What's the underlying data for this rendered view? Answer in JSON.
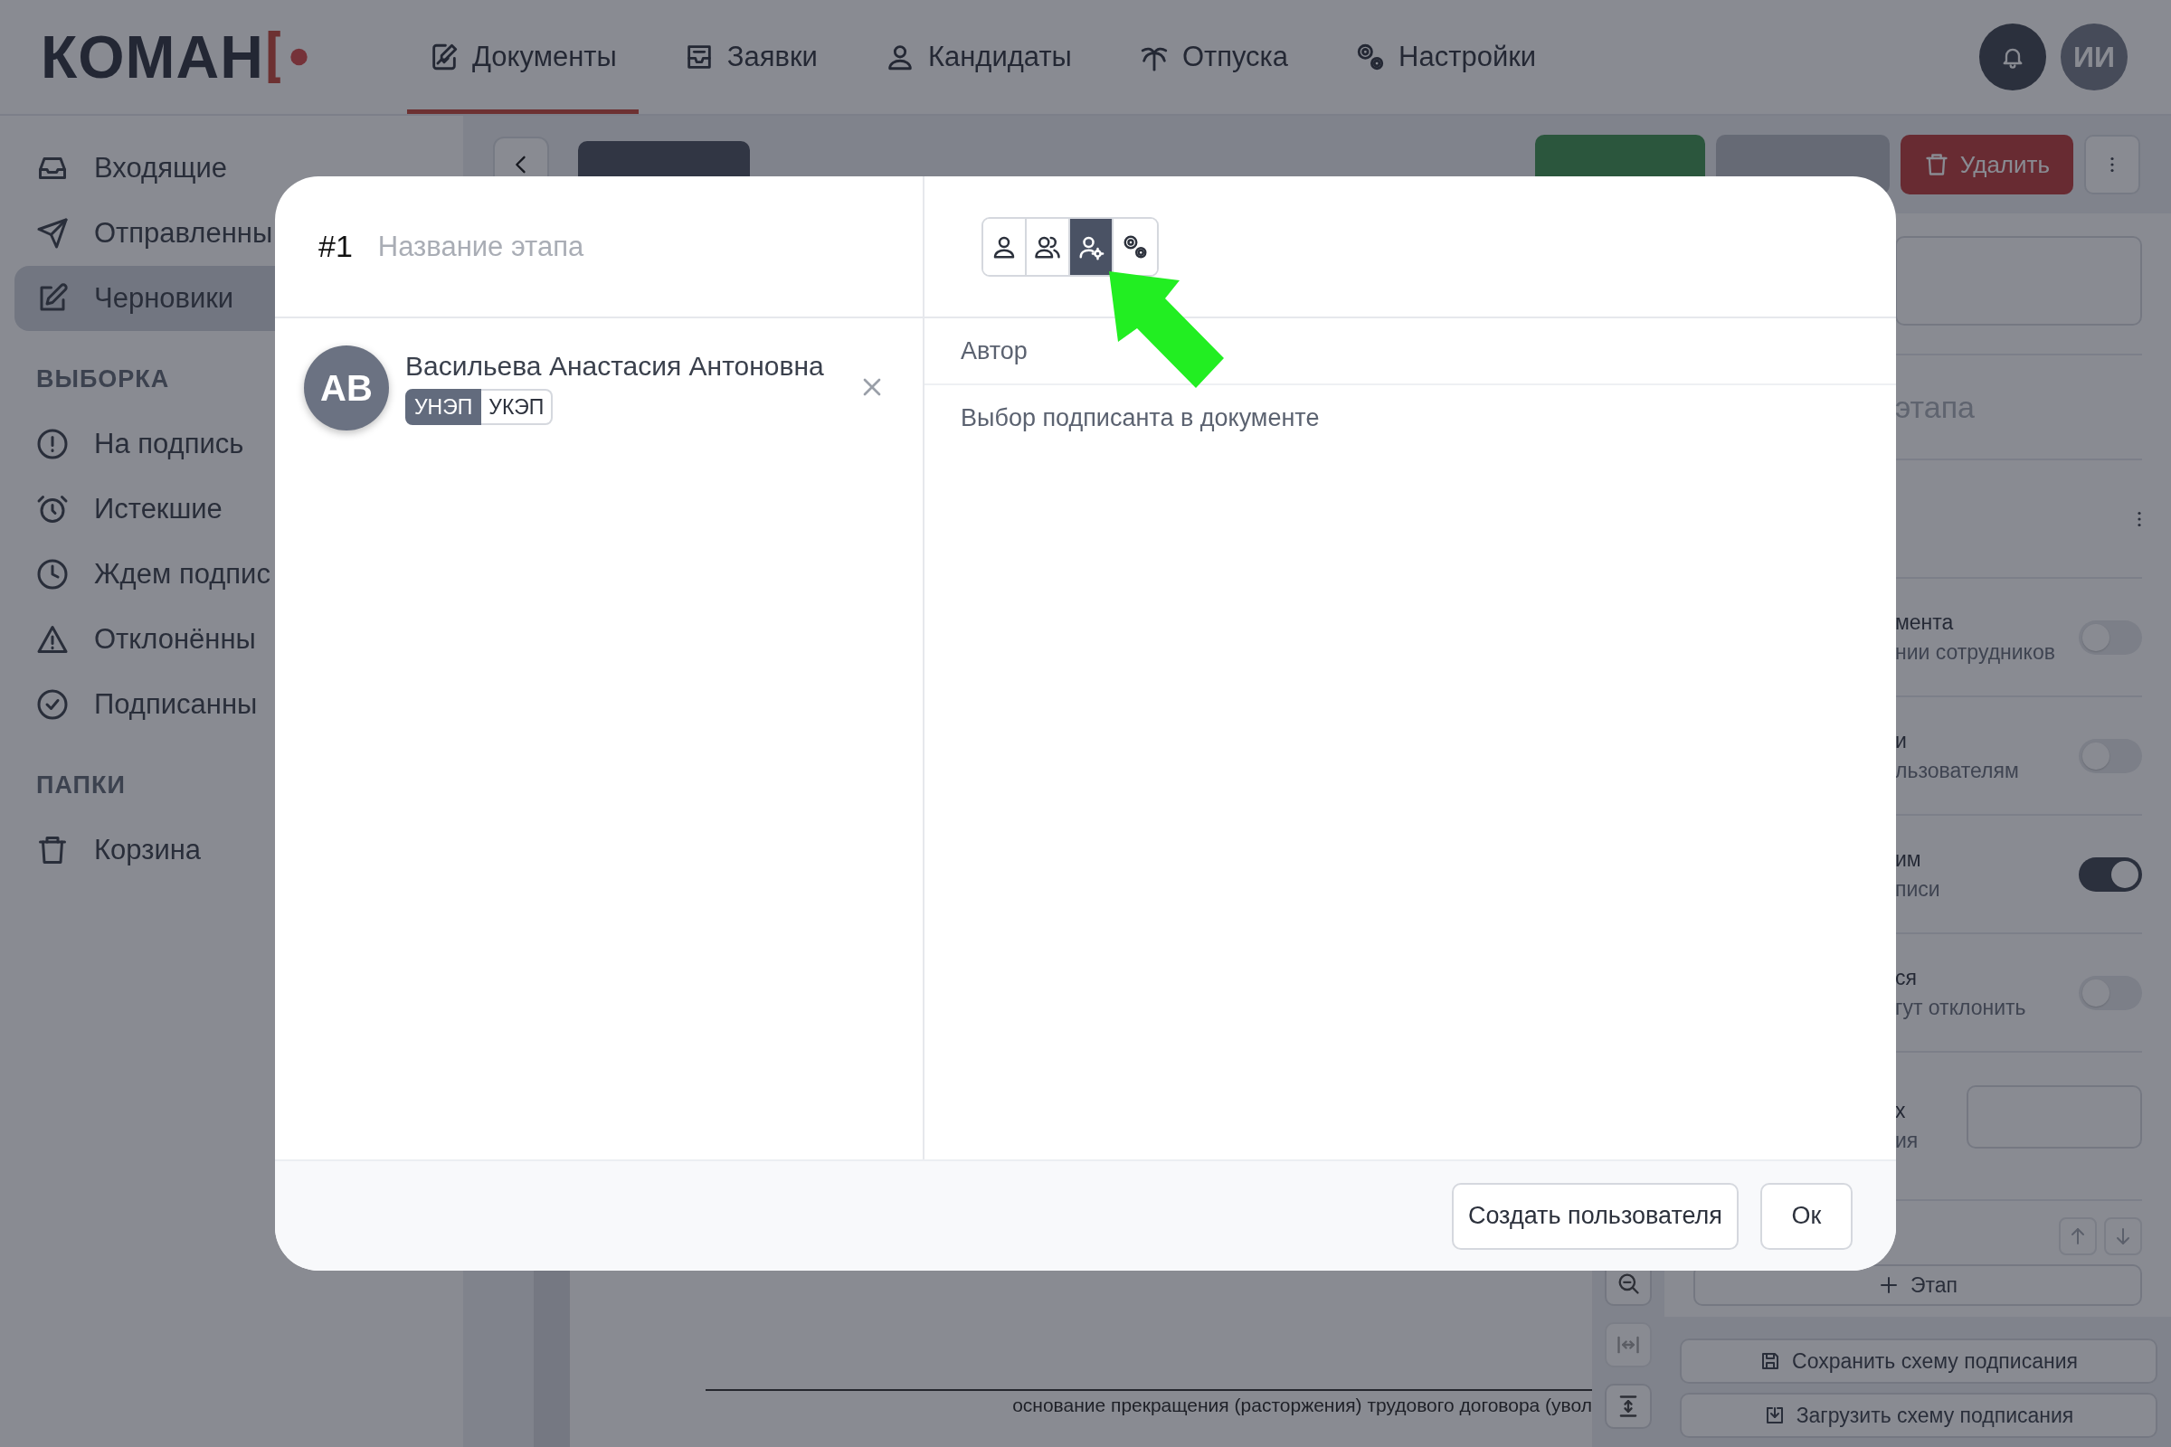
{
  "logo": {
    "text": "КОМАН"
  },
  "nav": [
    {
      "label": "Документы",
      "selected": true
    },
    {
      "label": "Заявки",
      "selected": false
    },
    {
      "label": "Кандидаты",
      "selected": false
    },
    {
      "label": "Отпуска",
      "selected": false
    },
    {
      "label": "Настройки",
      "selected": false
    }
  ],
  "user": {
    "initials": "ИИ"
  },
  "sidebar": {
    "items": [
      {
        "label": "Входящие",
        "selected": false
      },
      {
        "label": "Отправленны",
        "selected": false
      },
      {
        "label": "Черновики",
        "selected": true
      }
    ],
    "sections": [
      {
        "heading": "ВЫБОРКА",
        "items": [
          {
            "label": "На подпись",
            "selected": false
          },
          {
            "label": "Истекшие",
            "selected": false
          },
          {
            "label": "Ждем подпис",
            "selected": false
          },
          {
            "label": "Отклонённы",
            "selected": false
          },
          {
            "label": "Подписанны",
            "selected": false
          }
        ]
      },
      {
        "heading": "ПАПКИ",
        "items": [
          {
            "label": "Корзина",
            "selected": false
          }
        ]
      }
    ]
  },
  "toolbar": {
    "delete_label": "Удалить"
  },
  "document": {
    "text": "основание прекращения (расторжения) трудового договора (увол"
  },
  "panel": {
    "title": "этапа",
    "rows": [
      {
        "kind": "toggle",
        "lines": [
          "мента",
          "нии сотрудников"
        ],
        "on": false
      },
      {
        "kind": "toggle",
        "lines": [
          "и",
          "льзователям"
        ],
        "on": false
      },
      {
        "kind": "toggle",
        "lines": [
          "им",
          "писи"
        ],
        "on": true
      },
      {
        "kind": "toggle",
        "lines": [
          "ся",
          "гут отклонить"
        ],
        "on": false
      },
      {
        "kind": "field",
        "lines": [
          "х",
          "ия"
        ]
      }
    ],
    "add_stage": "Этап",
    "buttons": [
      "Сохранить схему подписания",
      "Загрузить схему подписания"
    ]
  },
  "modal": {
    "stage_number": "#1",
    "name_placeholder": "Название этапа",
    "mode_buttons": [
      {
        "selected": false
      },
      {
        "selected": false
      },
      {
        "selected": true
      },
      {
        "selected": false
      }
    ],
    "signer": {
      "initials": "АВ",
      "name": "Васильева Анастасия Антоновна",
      "signature_types": [
        {
          "label": "УНЭП",
          "selected": true
        },
        {
          "label": "УКЭП",
          "selected": false
        }
      ]
    },
    "options": [
      "Автор",
      "Выбор подписанта в документе"
    ],
    "footer_buttons": [
      "Создать пользователя",
      "Ок"
    ]
  }
}
